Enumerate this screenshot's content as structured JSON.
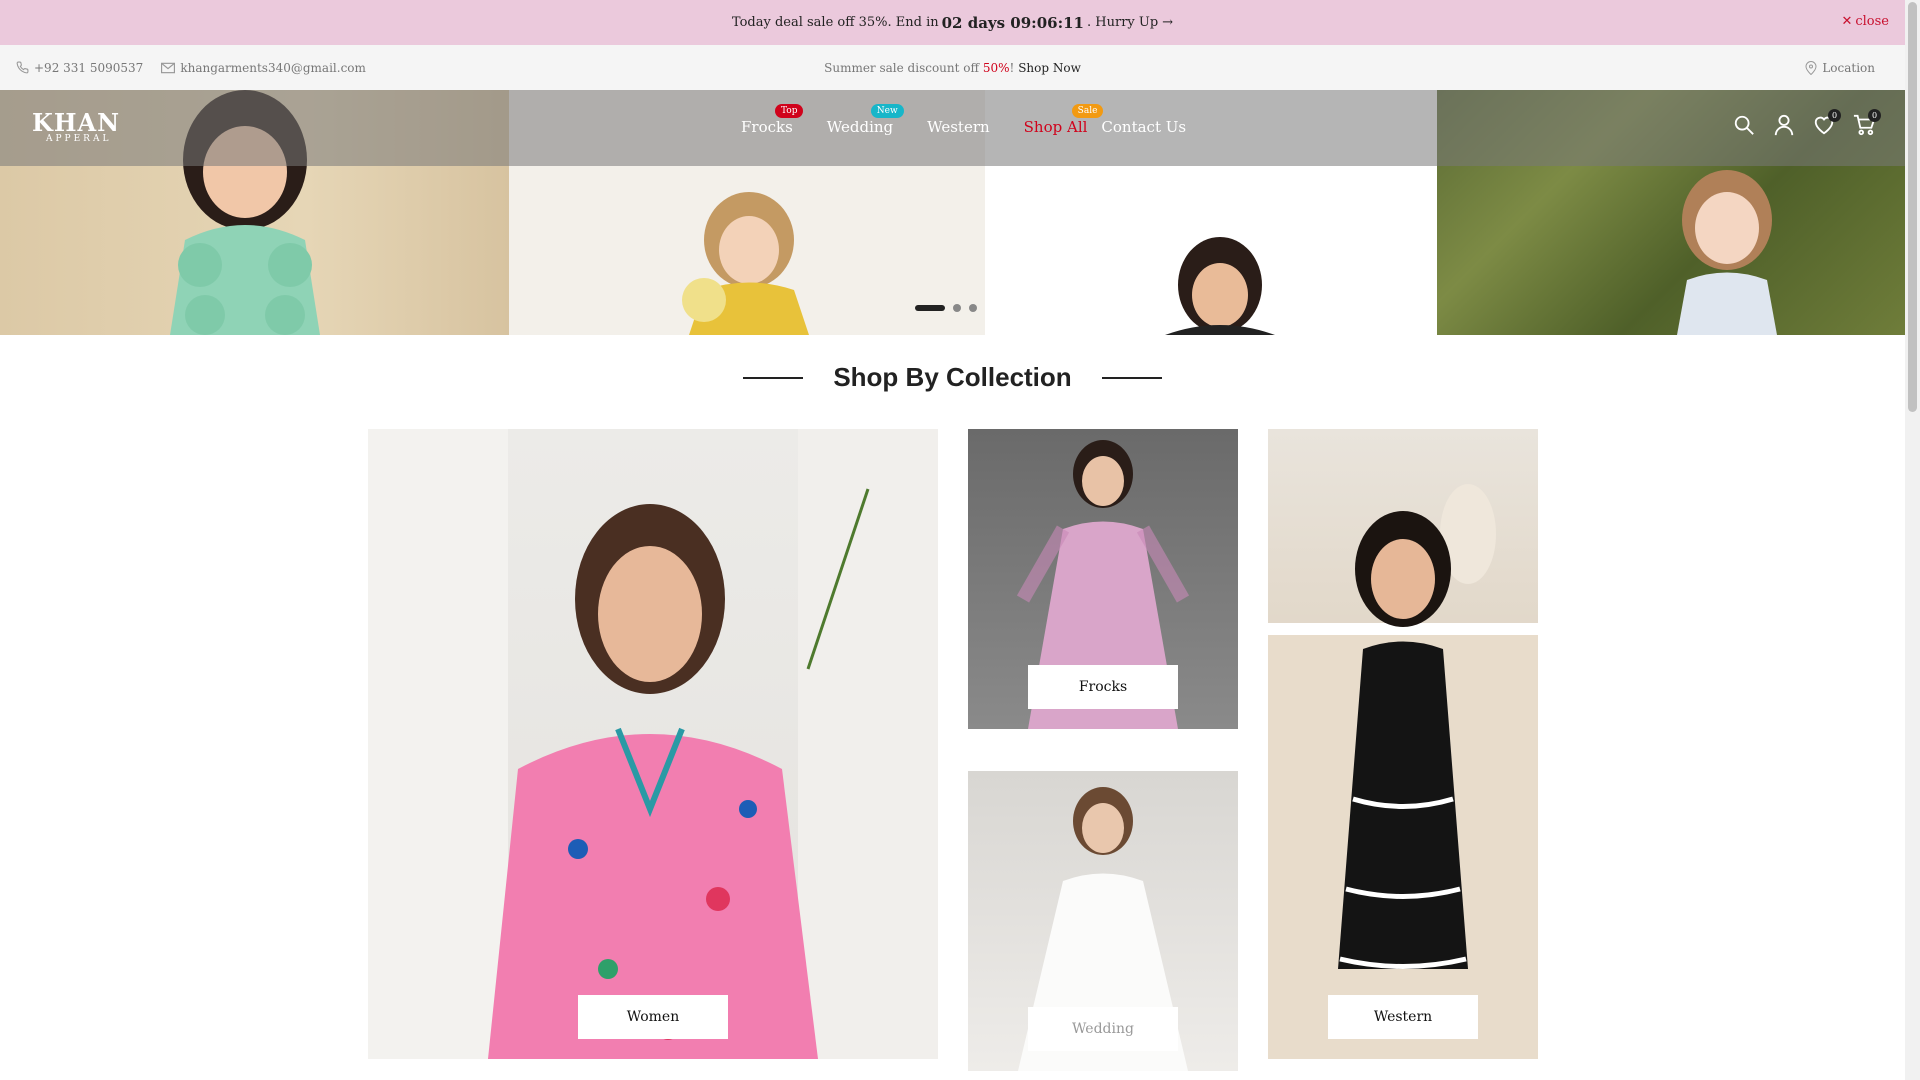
{
  "announcement": {
    "text_before": "Today deal sale off 35%. End in",
    "countdown": "02 days 09:06:11",
    "text_after": ". Hurry Up",
    "close_label": "close"
  },
  "topbar": {
    "phone": "+92 331 5090537",
    "email": "khangarments340@gmail.com",
    "promo_before": "Summer sale discount off",
    "promo_highlight": "50%",
    "promo_after": "!",
    "promo_link": "Shop Now",
    "location": "Location"
  },
  "header": {
    "logo_brand": "KHAN",
    "logo_sub": "APPERAL",
    "nav": [
      {
        "label": "Frocks",
        "badge": "Top"
      },
      {
        "label": "Wedding",
        "badge": "New"
      },
      {
        "label": "Western",
        "badge": ""
      },
      {
        "label": "Shop All",
        "badge": "Sale"
      },
      {
        "label": "Contact Us",
        "badge": ""
      }
    ],
    "wishlist_count": "0",
    "cart_count": "0"
  },
  "section": {
    "title": "Shop By Collection"
  },
  "collections": [
    {
      "label": "Women"
    },
    {
      "label": "Frocks"
    },
    {
      "label": "Wedding"
    },
    {
      "label": "Western"
    }
  ],
  "colors": {
    "announce_bg": "#ebc9dc",
    "accent_red": "#d0021b",
    "badge_new": "#17b6c9",
    "badge_sale": "#f29a12"
  }
}
